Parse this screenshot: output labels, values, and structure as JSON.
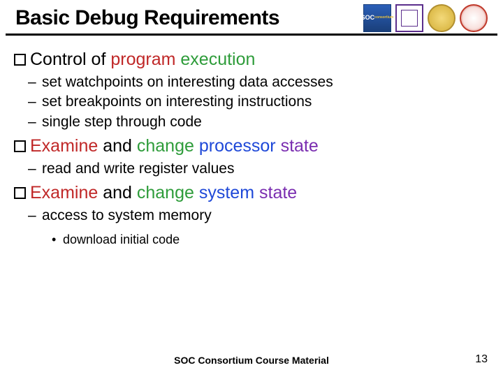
{
  "title": "Basic Debug Requirements",
  "logos": {
    "soc": {
      "line1": "SOC",
      "line2": "consortium"
    }
  },
  "bullets": [
    {
      "segments": [
        {
          "t": "Control",
          "cls": "seg1"
        },
        {
          "t": " of ",
          "cls": "seg1"
        },
        {
          "t": "program",
          "cls": "color-red"
        },
        {
          "t": " ",
          "cls": "seg1"
        },
        {
          "t": "execution",
          "cls": "color-green"
        }
      ],
      "subs": [
        "set watchpoints on interesting data accesses",
        "set breakpoints on interesting instructions",
        "single step through code"
      ],
      "subsub": []
    },
    {
      "segments": [
        {
          "t": "Examine",
          "cls": "color-red"
        },
        {
          "t": " and ",
          "cls": "seg1"
        },
        {
          "t": "change",
          "cls": "color-green"
        },
        {
          "t": " ",
          "cls": "seg1"
        },
        {
          "t": "processor",
          "cls": "color-blue"
        },
        {
          "t": " ",
          "cls": "seg1"
        },
        {
          "t": "state",
          "cls": "color-purple"
        }
      ],
      "subs": [
        "read and write register values"
      ],
      "subsub": []
    },
    {
      "segments": [
        {
          "t": "Examine",
          "cls": "color-red"
        },
        {
          "t": " and ",
          "cls": "seg1"
        },
        {
          "t": "change",
          "cls": "color-green"
        },
        {
          "t": " ",
          "cls": "seg1"
        },
        {
          "t": "system",
          "cls": "color-blue"
        },
        {
          "t": " ",
          "cls": "seg1"
        },
        {
          "t": "state",
          "cls": "color-purple"
        }
      ],
      "subs": [
        "access to system memory"
      ],
      "subsub": [
        "download initial code"
      ]
    }
  ],
  "footer": "SOC Consortium Course Material",
  "page": "13"
}
